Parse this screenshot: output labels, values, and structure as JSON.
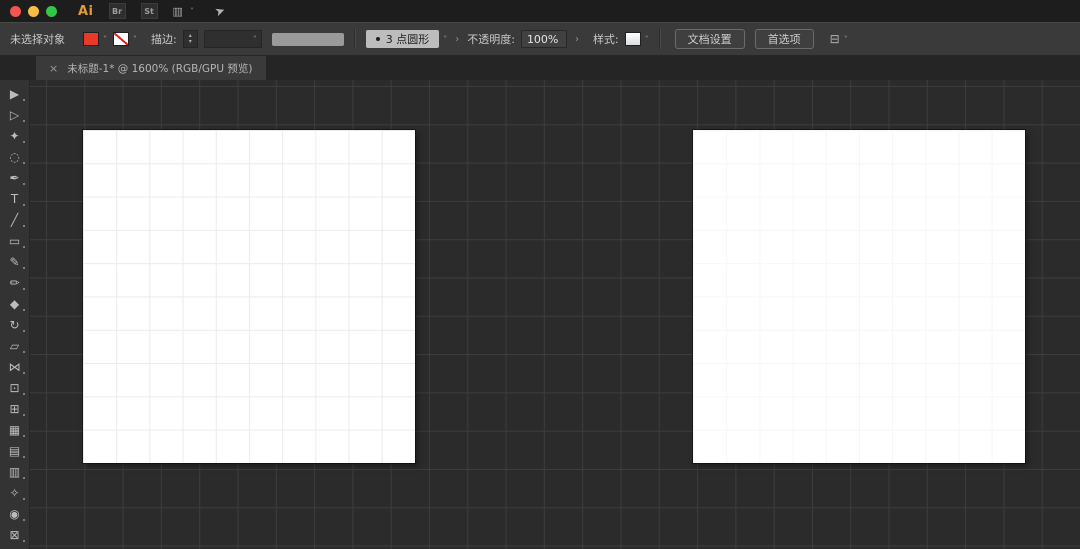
{
  "titlebar": {
    "logo": "Ai",
    "badges": [
      {
        "label": "Br"
      },
      {
        "label": "St"
      }
    ],
    "workspace_icon": "▥",
    "workspace_chevron": "˅",
    "share_icon": "➤"
  },
  "control_bar": {
    "selection_status": "未选择对象",
    "fill_chevron": "˅",
    "stroke_none_chevron": "˅",
    "stroke_label": "描边:",
    "stepper_up": "▴",
    "stepper_down": "▾",
    "stroke_dropdown_chevron": "˅",
    "brush_dot": "•",
    "brush_name": "3 点圆形",
    "brush_chevron": "˅",
    "expander": "›",
    "opacity_label": "不透明度:",
    "opacity_value": "100%",
    "opacity_expander": "›",
    "style_label": "样式:",
    "style_chevron": "˅",
    "document_setup_button": "文档设置",
    "preferences_button": "首选项",
    "panel_icon": "⊟",
    "panel_chevron": "˅"
  },
  "document_tab": {
    "close": "×",
    "title": "未标题-1* @ 1600% (RGB/GPU 预览)"
  },
  "toolbar": {
    "tools": [
      {
        "name": "selection-tool",
        "glyph": "▶"
      },
      {
        "name": "direct-selection-tool",
        "glyph": "▷"
      },
      {
        "name": "magic-wand-tool",
        "glyph": "✦"
      },
      {
        "name": "lasso-tool",
        "glyph": "◌"
      },
      {
        "name": "pen-tool",
        "glyph": "✒"
      },
      {
        "name": "type-tool",
        "glyph": "T"
      },
      {
        "name": "line-segment-tool",
        "glyph": "╱"
      },
      {
        "name": "rectangle-tool",
        "glyph": "▭"
      },
      {
        "name": "paintbrush-tool",
        "glyph": "✎"
      },
      {
        "name": "shaper-tool",
        "glyph": "✏"
      },
      {
        "name": "eraser-tool",
        "glyph": "◆"
      },
      {
        "name": "rotate-tool",
        "glyph": "↻"
      },
      {
        "name": "scale-tool",
        "glyph": "▱"
      },
      {
        "name": "width-tool",
        "glyph": "⋈"
      },
      {
        "name": "free-transform-tool",
        "glyph": "⊡"
      },
      {
        "name": "shape-builder-tool",
        "glyph": "⊞"
      },
      {
        "name": "perspective-grid-tool",
        "glyph": "▦"
      },
      {
        "name": "mesh-tool",
        "glyph": "▤"
      },
      {
        "name": "gradient-tool",
        "glyph": "▥"
      },
      {
        "name": "eyedropper-tool",
        "glyph": "✧"
      },
      {
        "name": "blend-tool",
        "glyph": "◉"
      },
      {
        "name": "artboard-tool",
        "glyph": "⊠"
      }
    ]
  },
  "canvas": {
    "artboard_count": 2
  },
  "colors": {
    "fill_swatch": "#e8392b",
    "logo_accent": "#e09c3c",
    "traffic_red": "#f4564f",
    "traffic_yellow": "#f8bd45",
    "traffic_green": "#33c748",
    "canvas_background": "#2b2b2b",
    "canvas_gridline": "#3d3d3d",
    "artboard": "#ffffff"
  }
}
